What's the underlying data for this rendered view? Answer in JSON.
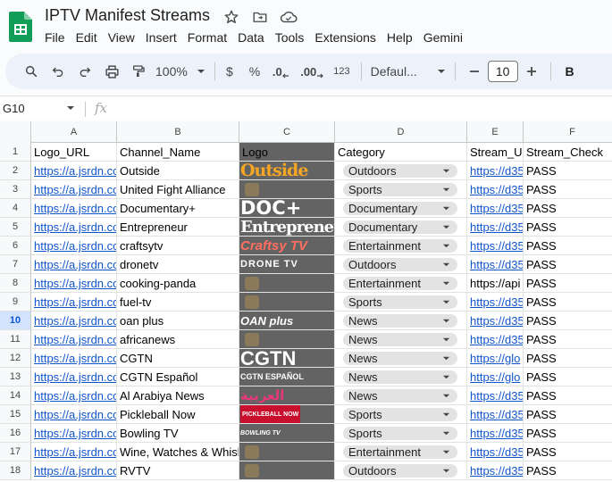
{
  "title": "IPTV Manifest Streams",
  "menu": [
    "File",
    "Edit",
    "View",
    "Insert",
    "Format",
    "Data",
    "Tools",
    "Extensions",
    "Help",
    "Gemini"
  ],
  "toolbar": {
    "zoom": "100%",
    "currency": "$",
    "percent": "%",
    "decrease_decimal": ".0",
    "increase_decimal": ".00",
    "number_format": "123",
    "font": "Defaul...",
    "font_size": "10",
    "bold": "B"
  },
  "namebox": "G10",
  "fx": "fx",
  "selected_row": 10,
  "column_letters": [
    "A",
    "B",
    "C",
    "D",
    "E",
    "F"
  ],
  "headers": [
    "Logo_URL",
    "Channel_Name",
    "Logo",
    "Category",
    "Stream_URL",
    "Stream_Check"
  ],
  "rows": [
    {
      "n": "2",
      "url": "https://a.jsrdn.com",
      "name": "Outside",
      "category": "Outdoors",
      "stream": "https://d35",
      "check": "PASS",
      "logo": "Outside"
    },
    {
      "n": "3",
      "url": "https://a.jsrdn.com",
      "name": "United Fight Alliance",
      "category": "Sports",
      "stream": "https://d35",
      "check": "PASS",
      "logo": ""
    },
    {
      "n": "4",
      "url": "https://a.jsrdn.com",
      "name": "Documentary+",
      "category": "Documentary",
      "stream": "https://d35",
      "check": "PASS",
      "logo": "DOC+"
    },
    {
      "n": "5",
      "url": "https://a.jsrdn.com",
      "name": "Entrepreneur",
      "category": "Documentary",
      "stream": "https://d35",
      "check": "PASS",
      "logo": "Entrepreneur"
    },
    {
      "n": "6",
      "url": "https://a.jsrdn.com",
      "name": "craftsytv",
      "category": "Entertainment",
      "stream": "https://d35",
      "check": "PASS",
      "logo": "Craftsy TV"
    },
    {
      "n": "7",
      "url": "https://a.jsrdn.com",
      "name": "dronetv",
      "category": "Outdoors",
      "stream": "https://d35",
      "check": "PASS",
      "logo": "DRONE TV"
    },
    {
      "n": "8",
      "url": "https://a.jsrdn.com",
      "name": "cooking-panda",
      "category": "Entertainment",
      "stream": "https://api",
      "check": "PASS",
      "logo": ""
    },
    {
      "n": "9",
      "url": "https://a.jsrdn.com",
      "name": "fuel-tv",
      "category": "Sports",
      "stream": "https://d35",
      "check": "PASS",
      "logo": ""
    },
    {
      "n": "10",
      "url": "https://a.jsrdn.com",
      "name": "oan plus",
      "category": "News",
      "stream": "https://d35",
      "check": "PASS",
      "logo": "OAN plus"
    },
    {
      "n": "11",
      "url": "https://a.jsrdn.com",
      "name": "africanews",
      "category": "News",
      "stream": "https://d35",
      "check": "PASS",
      "logo": ""
    },
    {
      "n": "12",
      "url": "https://a.jsrdn.com",
      "name": "CGTN",
      "category": "News",
      "stream": "https://glo",
      "check": "PASS",
      "logo": "CGTN"
    },
    {
      "n": "13",
      "url": "https://a.jsrdn.com",
      "name": "CGTN Español",
      "category": "News",
      "stream": "https://glo",
      "check": "PASS",
      "logo": "CGTN ESPAÑOL"
    },
    {
      "n": "14",
      "url": "https://a.jsrdn.com",
      "name": "Al Arabiya News",
      "category": "News",
      "stream": "https://d35",
      "check": "PASS",
      "logo": "العربية"
    },
    {
      "n": "15",
      "url": "https://a.jsrdn.com",
      "name": "Pickleball Now",
      "category": "Sports",
      "stream": "https://d35",
      "check": "PASS",
      "logo": "PICKLEBALL NOW"
    },
    {
      "n": "16",
      "url": "https://a.jsrdn.com",
      "name": "Bowling TV",
      "category": "Sports",
      "stream": "https://d35",
      "check": "PASS",
      "logo": "BOWLING TV"
    },
    {
      "n": "17",
      "url": "https://a.jsrdn.com",
      "name": "Wine, Watches & Whiskey",
      "category": "Entertainment",
      "stream": "https://d35",
      "check": "PASS",
      "logo": ""
    },
    {
      "n": "18",
      "url": "https://a.jsrdn.com",
      "name": "RVTV",
      "category": "Outdoors",
      "stream": "https://d35",
      "check": "PASS",
      "logo": ""
    }
  ],
  "colors": {
    "sheets_green": "#0f9d58",
    "link": "#1155cc",
    "logo_column": "#636363",
    "chip": "#e3e3e3",
    "selected_row": "#d3e3fd"
  }
}
